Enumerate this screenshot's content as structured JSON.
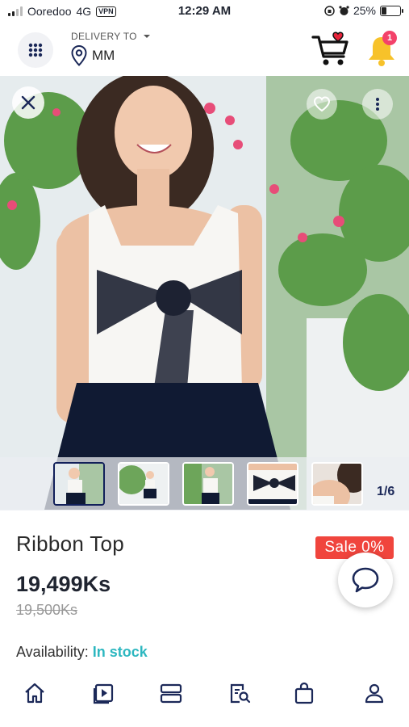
{
  "status_bar": {
    "carrier": "Ooredoo",
    "network": "4G",
    "vpn": "VPN",
    "time": "12:29 AM",
    "battery": "25%",
    "battery_level": 0.25
  },
  "header": {
    "delivery_label": "DELIVERY TO",
    "delivery_location": "MM",
    "notification_count": "1",
    "icons": [
      "grid-icon",
      "chevron-down-icon",
      "location-pin-icon",
      "cart-icon",
      "bell-icon"
    ]
  },
  "gallery": {
    "counter": "1/6",
    "thumbnail_count": 5,
    "active_index": 0
  },
  "product": {
    "name": "Ribbon Top",
    "sale_badge": "Sale 0%",
    "price": "19,499Ks",
    "original_price": "19,500Ks",
    "availability_label": "Availability:",
    "availability_value": "In stock"
  },
  "colors": {
    "accent": "#12205a",
    "sale": "#f0453d",
    "in_stock": "#2db7c0",
    "badge": "#f3426a"
  },
  "bottom_nav": [
    "home-icon",
    "video-icon",
    "categories-icon",
    "search-document-icon",
    "shopping-bag-icon",
    "profile-icon"
  ]
}
